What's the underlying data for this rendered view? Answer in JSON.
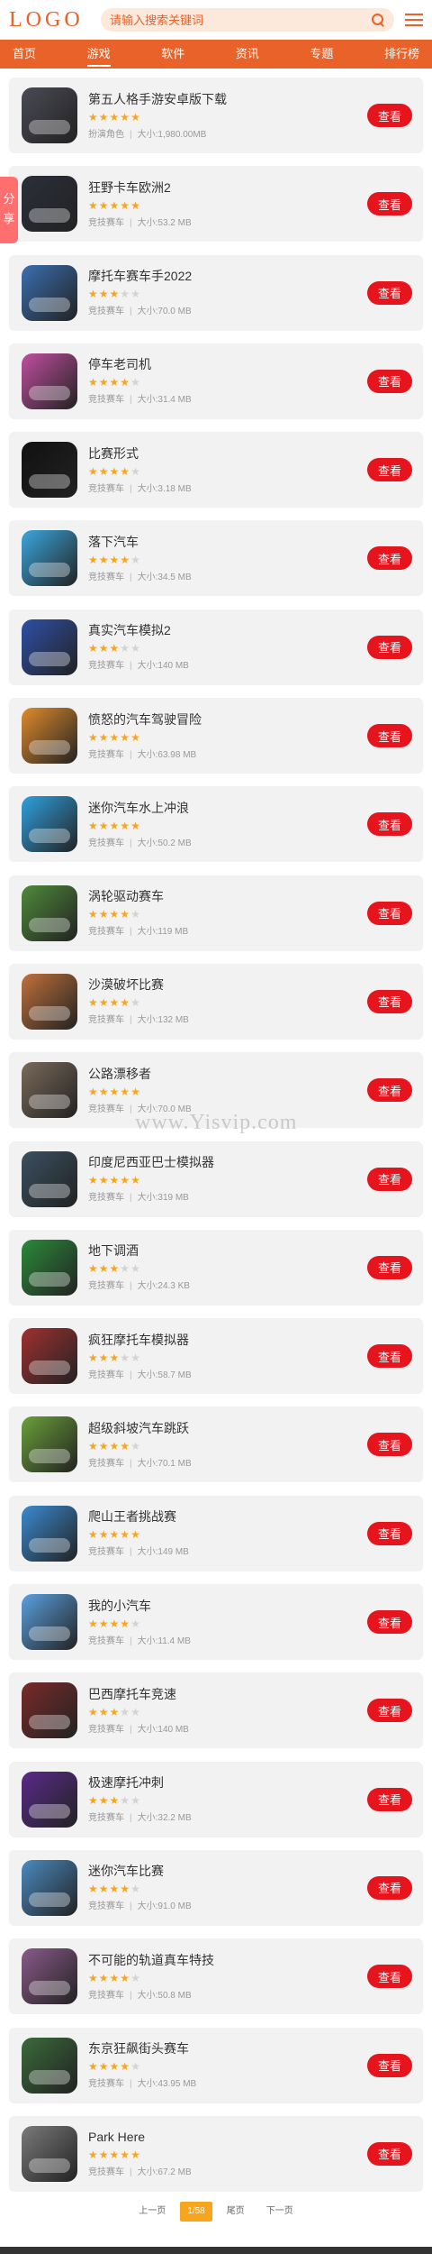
{
  "header": {
    "logo": "LOGO",
    "search_placeholder": "请输入搜索关键词"
  },
  "nav": [
    {
      "label": "首页",
      "active": false
    },
    {
      "label": "游戏",
      "active": true
    },
    {
      "label": "软件",
      "active": false
    },
    {
      "label": "资讯",
      "active": false
    },
    {
      "label": "专题",
      "active": false
    },
    {
      "label": "排行榜",
      "active": false
    }
  ],
  "share_label": "分享",
  "watermark": "www.Yisvip.com",
  "button_label": "查看",
  "size_prefix": "大小:",
  "games": [
    {
      "name": "第五人格手游安卓版下载",
      "rating": 5,
      "category": "扮演角色",
      "size": "1,980.00MB",
      "color": "#4a4a55"
    },
    {
      "name": "狂野卡车欧洲2",
      "rating": 5,
      "category": "竞技赛车",
      "size": "53.2 MB",
      "color": "#2b2f3a"
    },
    {
      "name": "摩托车赛车手2022",
      "rating": 3,
      "category": "竞技赛车",
      "size": "70.0 MB",
      "color": "#3a6fb0"
    },
    {
      "name": "停车老司机",
      "rating": 4,
      "category": "竞技赛车",
      "size": "31.4 MB",
      "color": "#c04fa0"
    },
    {
      "name": "比赛形式",
      "rating": 4,
      "category": "竞技赛车",
      "size": "3.18 MB",
      "color": "#111111"
    },
    {
      "name": "落下汽车",
      "rating": 4,
      "category": "竞技赛车",
      "size": "34.5 MB",
      "color": "#3aa7e0"
    },
    {
      "name": "真实汽车模拟2",
      "rating": 3,
      "category": "竞技赛车",
      "size": "140 MB",
      "color": "#2e4fa8"
    },
    {
      "name": "愤怒的汽车驾驶冒险",
      "rating": 5,
      "category": "竞技赛车",
      "size": "63.98 MB",
      "color": "#e08a2c"
    },
    {
      "name": "迷你汽车水上冲浪",
      "rating": 5,
      "category": "竞技赛车",
      "size": "50.2 MB",
      "color": "#2fa0e0"
    },
    {
      "name": "涡轮驱动赛车",
      "rating": 4,
      "category": "竞技赛车",
      "size": "119 MB",
      "color": "#4f8a3a"
    },
    {
      "name": "沙漠破坏比赛",
      "rating": 4,
      "category": "竞技赛车",
      "size": "132 MB",
      "color": "#c0703a"
    },
    {
      "name": "公路漂移者",
      "rating": 5,
      "category": "竞技赛车",
      "size": "70.0 MB",
      "color": "#7a6a5a"
    },
    {
      "name": "印度尼西亚巴士模拟器",
      "rating": 5,
      "category": "竞技赛车",
      "size": "319 MB",
      "color": "#3a5060"
    },
    {
      "name": "地下调酒",
      "rating": 3,
      "category": "竞技赛车",
      "size": "24.3 KB",
      "color": "#2a8a3a"
    },
    {
      "name": "疯狂摩托车模拟器",
      "rating": 3,
      "category": "竞技赛车",
      "size": "58.7 MB",
      "color": "#a03030"
    },
    {
      "name": "超级斜坡汽车跳跃",
      "rating": 4,
      "category": "竞技赛车",
      "size": "70.1 MB",
      "color": "#6aa03a"
    },
    {
      "name": "爬山王者挑战赛",
      "rating": 5,
      "category": "竞技赛车",
      "size": "149 MB",
      "color": "#3a8ad0"
    },
    {
      "name": "我的小汽车",
      "rating": 4,
      "category": "竞技赛车",
      "size": "11.4 MB",
      "color": "#5aa0e0"
    },
    {
      "name": "巴西摩托车竞速",
      "rating": 3,
      "category": "竞技赛车",
      "size": "140 MB",
      "color": "#7a2a2a"
    },
    {
      "name": "极速摩托冲刺",
      "rating": 3,
      "category": "竞技赛车",
      "size": "32.2 MB",
      "color": "#5a2a8a"
    },
    {
      "name": "迷你汽车比赛",
      "rating": 4,
      "category": "竞技赛车",
      "size": "91.0 MB",
      "color": "#4a8ac0"
    },
    {
      "name": "不可能的轨道真车特技",
      "rating": 4,
      "category": "竞技赛车",
      "size": "50.8 MB",
      "color": "#8a5a8a"
    },
    {
      "name": "东京狂飙街头赛车",
      "rating": 4,
      "category": "竞技赛车",
      "size": "43.95 MB",
      "color": "#3a6a3a"
    },
    {
      "name": "Park Here",
      "rating": 5,
      "category": "竞技赛车",
      "size": "67.2 MB",
      "color": "#7a7a7a"
    }
  ],
  "pagination": {
    "prev": "上一页",
    "current": "1/58",
    "last": "尾页",
    "next": "下一页"
  },
  "colors": {
    "accent": "#e8622a",
    "button": "#e6141d",
    "star": "#f7a51c"
  }
}
